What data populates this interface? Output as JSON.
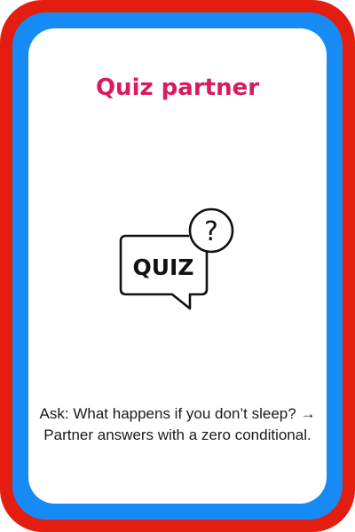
{
  "card": {
    "title": "Quiz partner",
    "icon_name": "quiz-speech-bubble-question-icon",
    "icon_text": "QUIZ",
    "icon_question_mark": "?",
    "caption": "Ask: What happens if you don’t sleep? → Partner answers with a zero conditional."
  },
  "colors": {
    "outer_border": "#e31e0f",
    "inner_border": "#168af5",
    "title": "#d81b5c",
    "text": "#1a1a1a",
    "background": "#ffffff"
  }
}
